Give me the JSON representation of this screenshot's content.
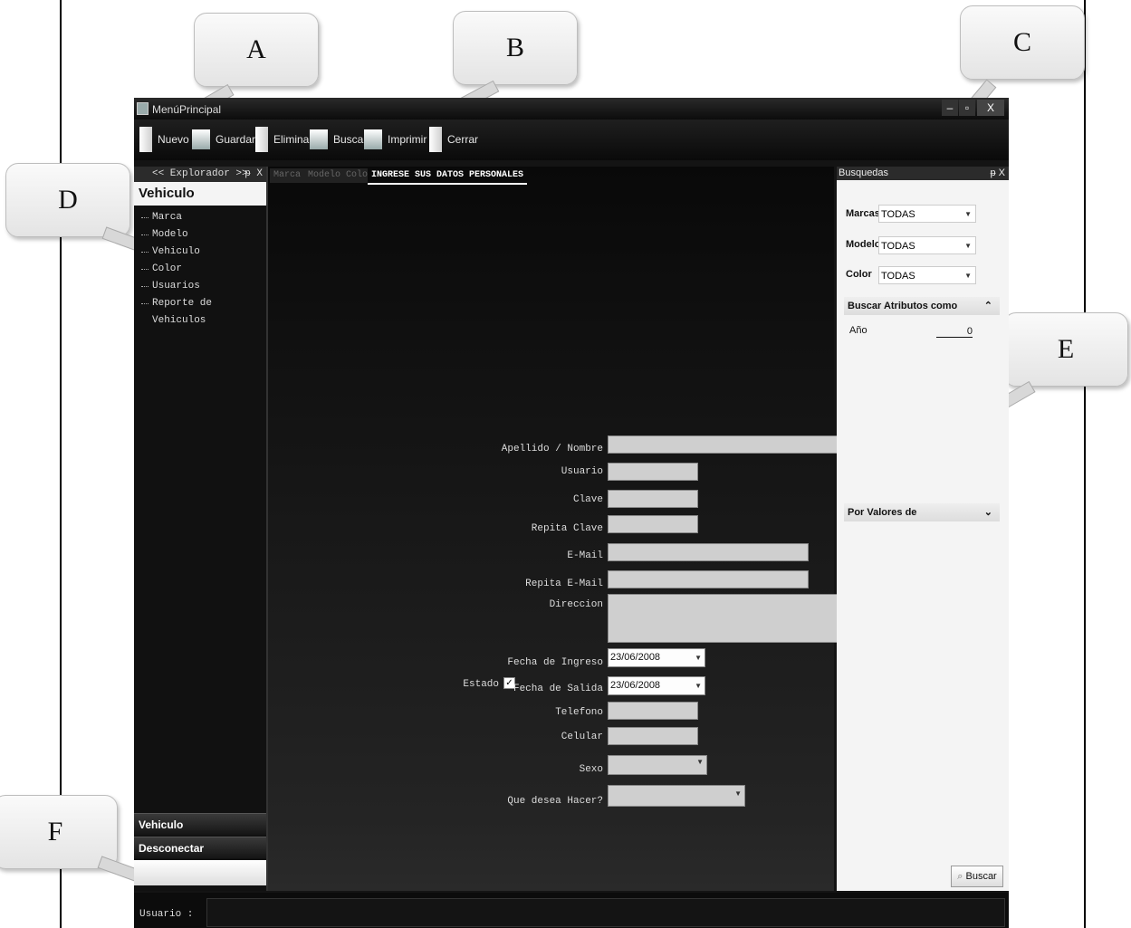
{
  "callouts": {
    "a": "A",
    "b": "B",
    "c": "C",
    "d": "D",
    "e": "E",
    "f": "F"
  },
  "window": {
    "title": "MenúPrincipal",
    "minimize": "–",
    "maximize": "▫",
    "close": "X"
  },
  "toolbar": {
    "nuevo": "Nuevo",
    "guardar": "Guardar",
    "eliminar": "Eliminar",
    "buscar": "Buscar",
    "imprimir": "Imprimir",
    "cerrar": "Cerrar"
  },
  "explorer": {
    "header": "<< Explorador >>",
    "pin": "ᵽ X",
    "title": "Vehiculo",
    "items": [
      "Marca",
      "Modelo",
      "Vehiculo",
      "Color",
      "Usuarios",
      "Reporte de Vehiculos"
    ],
    "nav": [
      "Vehiculo",
      "Desconectar"
    ]
  },
  "tabs": {
    "dim": [
      "Marca",
      "Modelo",
      "Color"
    ],
    "active": "INGRESE SUS DATOS PERSONALES"
  },
  "form": {
    "apellido": "Apellido / Nombre",
    "usuario": "Usuario",
    "clave": "Clave",
    "repita_clave": "Repita Clave",
    "email": "E-Mail",
    "repita_email": "Repita E-Mail",
    "direccion": "Direccion",
    "fecha_ingreso": "Fecha de Ingreso",
    "fecha_ingreso_val": "23/06/2008",
    "estado": "Estado",
    "estado_check": "✓",
    "fecha_salida": "Fecha de Salida",
    "fecha_salida_val": "23/06/2008",
    "telefono": "Telefono",
    "celular": "Celular",
    "sexo": "Sexo",
    "que_hacer": "Que desea Hacer?"
  },
  "busquedas": {
    "title": "Busquedas",
    "pin": "ᵽ X",
    "marcas_label": "Marcas",
    "marcas_val": "TODAS",
    "modelo_label": "Modelo",
    "modelo_val": "TODAS",
    "color_label": "Color",
    "color_val": "TODAS",
    "atributos": "Buscar Atributos como",
    "anio": "Año",
    "anio_val": "0",
    "valores": "Por Valores de",
    "buscar_btn": "Buscar"
  },
  "status": {
    "usuario": "Usuario :"
  }
}
